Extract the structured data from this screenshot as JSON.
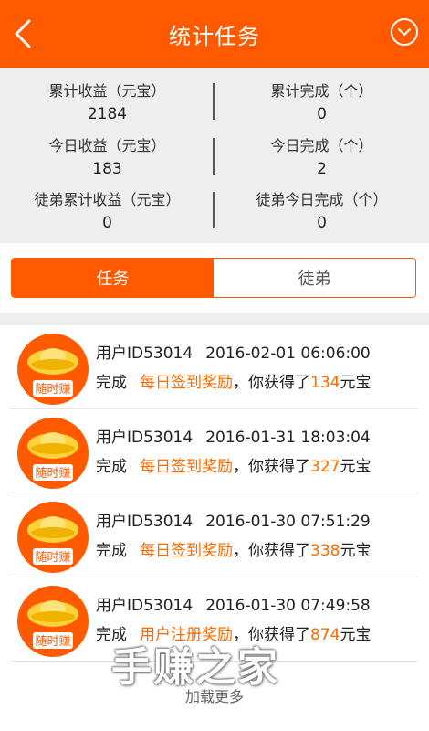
{
  "header": {
    "title": "统计任务",
    "back_icon": "chevron-left-icon",
    "menu_icon": "chevron-down-circle-icon"
  },
  "stats": [
    {
      "left_label": "累计收益（元宝）",
      "left_value": "2184",
      "right_label": "累计完成（个）",
      "right_value": "0"
    },
    {
      "left_label": "今日收益（元宝）",
      "left_value": "183",
      "right_label": "今日完成（个）",
      "right_value": "2"
    },
    {
      "left_label": "徒弟累计收益（元宝）",
      "left_value": "0",
      "right_label": "徒弟今日完成（个）",
      "right_value": "0"
    }
  ],
  "tabs": [
    {
      "label": "任务",
      "active": true
    },
    {
      "label": "徒弟",
      "active": false
    }
  ],
  "records": [
    {
      "user": "用户ID53014",
      "time": "2016-02-01 06:06:00",
      "prefix": "完成",
      "task": "每日签到奖励",
      "middle": "，你获得了",
      "amount": "134",
      "unit": "元宝",
      "avatar_text": "随时赚"
    },
    {
      "user": "用户ID53014",
      "time": "2016-01-31 18:03:04",
      "prefix": "完成",
      "task": "每日签到奖励",
      "middle": "，你获得了",
      "amount": "327",
      "unit": "元宝",
      "avatar_text": "随时赚"
    },
    {
      "user": "用户ID53014",
      "time": "2016-01-30 07:51:29",
      "prefix": "完成",
      "task": "每日签到奖励",
      "middle": "，你获得了",
      "amount": "338",
      "unit": "元宝",
      "avatar_text": "随时赚"
    },
    {
      "user": "用户ID53014",
      "time": "2016-01-30 07:49:58",
      "prefix": "完成",
      "task": "用户注册奖励",
      "middle": "，你获得了",
      "amount": "874",
      "unit": "元宝",
      "avatar_text": "随时赚"
    }
  ],
  "load_more": "加载更多",
  "watermark": "手赚之家",
  "colors": {
    "accent": "#ff5a00",
    "highlight": "#ff6a00",
    "panel": "#eeeeee"
  }
}
